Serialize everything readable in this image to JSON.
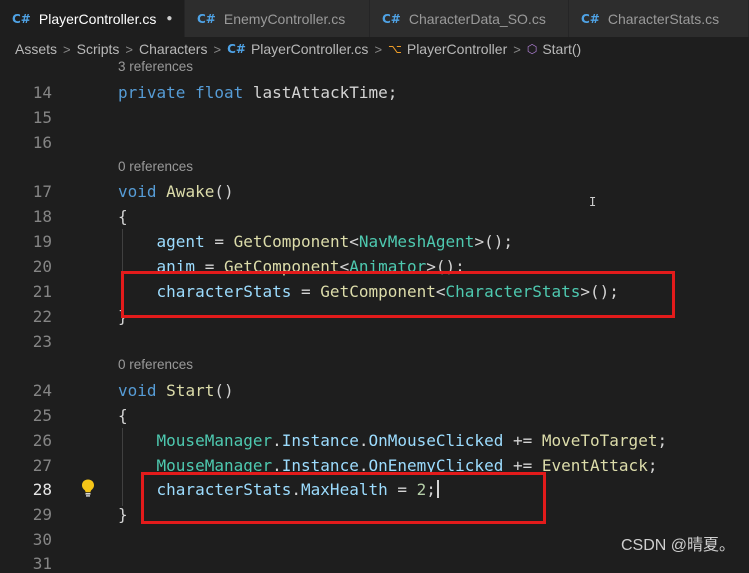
{
  "tabs": [
    {
      "label": "PlayerController.cs",
      "active": true,
      "modified": true
    },
    {
      "label": "EnemyController.cs"
    },
    {
      "label": "CharacterData_SO.cs"
    },
    {
      "label": "CharacterStats.cs"
    }
  ],
  "icons": {
    "cs_file": "C#",
    "modified_dot": "●",
    "separator": ">",
    "class": "⌥",
    "method": "⬡"
  },
  "breadcrumb": [
    "Assets",
    "Scripts",
    "Characters",
    "PlayerController.cs",
    "PlayerController",
    "Start()"
  ],
  "code_lens": [
    "3 references",
    "0 references",
    "0 references"
  ],
  "line_numbers": [
    "14",
    "15",
    "16",
    "17",
    "18",
    "19",
    "20",
    "21",
    "22",
    "23",
    "24",
    "25",
    "26",
    "27",
    "28",
    "29",
    "30",
    "31"
  ],
  "code": {
    "line14": {
      "kw1": "private",
      "kw2": "float",
      "name": "lastAttackTime;"
    },
    "line17": {
      "kw": "void",
      "fn": "Awake",
      "rest": "()"
    },
    "line18": {
      "text": "{"
    },
    "line19": {
      "var": "agent",
      "eq": " = ",
      "fn": "GetComponent",
      "lt": "<",
      "type": "NavMeshAgent",
      "end": ">();"
    },
    "line20": {
      "var": "anim",
      "eq": " = ",
      "fn": "GetComponent",
      "lt": "<",
      "type": "Animator",
      "end": ">();"
    },
    "line21": {
      "var": "characterStats",
      "eq": " = ",
      "fn": "GetComponent",
      "lt": "<",
      "type": "CharacterStats",
      "end": ">();"
    },
    "line22": {
      "text": "}"
    },
    "line24": {
      "kw": "void",
      "fn": "Start",
      "rest": "()"
    },
    "line25": {
      "text": "{"
    },
    "line26": {
      "type": "MouseManager",
      "dot1": ".",
      "var1": "Instance",
      "dot2": ".",
      "var2": "OnMouseClicked",
      "op": " += ",
      "fn": "MoveToTarget",
      "end": ";"
    },
    "line27": {
      "type": "MouseManager",
      "dot1": ".",
      "var1": "Instance",
      "dot2": ".",
      "var2": "OnEnemyClicked",
      "op": " += ",
      "fn": "EventAttack",
      "end": ";"
    },
    "line28": {
      "var1": "characterStats",
      "dot": ".",
      "var2": "MaxHealth",
      "eq": " = ",
      "num": "2",
      "end": ";"
    },
    "line29": {
      "text": "}"
    }
  },
  "watermark": "CSDN @晴夏。",
  "colors": {
    "background": "#1e1e1e",
    "keyword": "#569cd6",
    "function": "#dcdcaa",
    "type": "#4ec9b0",
    "variable": "#9cdcfe",
    "number": "#b5cea8",
    "annotation_box": "#e31b1b"
  }
}
